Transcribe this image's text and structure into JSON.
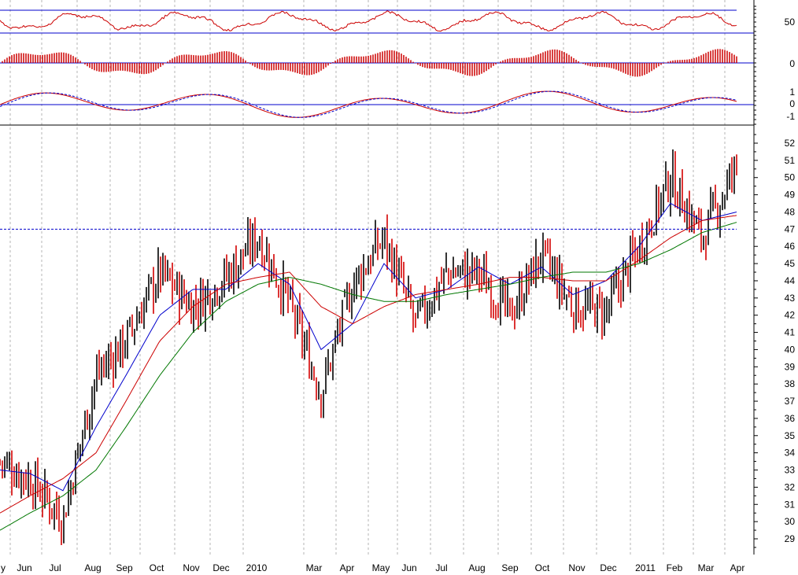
{
  "chart_data": {
    "type": "line",
    "title": "",
    "xlabel": "",
    "ylabel": "",
    "x_labels": [
      "y",
      "Jun",
      "Jul",
      "Aug",
      "Sep",
      "Oct",
      "Nov",
      "Dec",
      "2010",
      "Mar",
      "Apr",
      "May",
      "Jun",
      "Jul",
      "Aug",
      "Sep",
      "Oct",
      "Nov",
      "Dec",
      "2011",
      "Feb",
      "Mar",
      "Apr"
    ],
    "price_ticks": [
      52,
      51,
      50,
      49,
      48,
      47,
      46,
      45,
      44,
      43,
      42,
      41,
      40,
      39,
      38,
      37,
      36,
      35,
      34,
      33,
      32,
      31,
      30,
      29
    ],
    "ylim": [
      28.5,
      52.5
    ],
    "reference_level": 47,
    "panels": {
      "oscillator_1": {
        "tick_labels": [
          "50"
        ],
        "lines": [
          70,
          30
        ]
      },
      "histogram": {
        "tick_labels": [
          "0"
        ]
      },
      "oscillator_2": {
        "tick_labels": [
          "1",
          "0",
          "-1"
        ]
      }
    },
    "series": [
      {
        "type": "ohlc-bars",
        "color": "#000000",
        "down_color": "#d40000",
        "close_monthly": [
          33.5,
          32.5,
          30.2,
          38.5,
          40.5,
          44.5,
          42.5,
          44.2,
          46.6,
          42.6,
          37.5,
          43.8,
          46.5,
          41.5,
          44.5,
          44.5,
          42.0,
          45.5,
          42.5,
          42.2,
          46.0,
          50.0,
          46.5,
          50.7
        ]
      },
      {
        "type": "line",
        "color": "#0000cc",
        "values_monthly": [
          33.0,
          32.8,
          31.8,
          35.5,
          38.5,
          42.0,
          43.5,
          43.5,
          45.0,
          43.8,
          40.0,
          41.5,
          45.0,
          43.0,
          43.5,
          44.8,
          43.8,
          44.8,
          43.2,
          44.0,
          46.0,
          48.5,
          47.5,
          48.0
        ]
      },
      {
        "type": "line",
        "color": "#cc0000",
        "values_monthly": [
          30.5,
          31.5,
          32.5,
          34.0,
          37.0,
          40.5,
          42.5,
          43.8,
          44.2,
          44.5,
          42.5,
          41.5,
          42.5,
          43.2,
          43.5,
          43.8,
          44.2,
          44.2,
          44.0,
          44.0,
          45.2,
          46.5,
          47.5,
          47.8
        ]
      },
      {
        "type": "line",
        "color": "#007700",
        "values_monthly": [
          29.5,
          30.5,
          31.5,
          33.0,
          35.5,
          38.5,
          41.0,
          42.8,
          43.8,
          44.2,
          43.8,
          43.2,
          42.8,
          42.8,
          43.2,
          43.5,
          43.8,
          44.2,
          44.5,
          44.5,
          45.0,
          45.8,
          46.8,
          47.4
        ]
      }
    ]
  }
}
